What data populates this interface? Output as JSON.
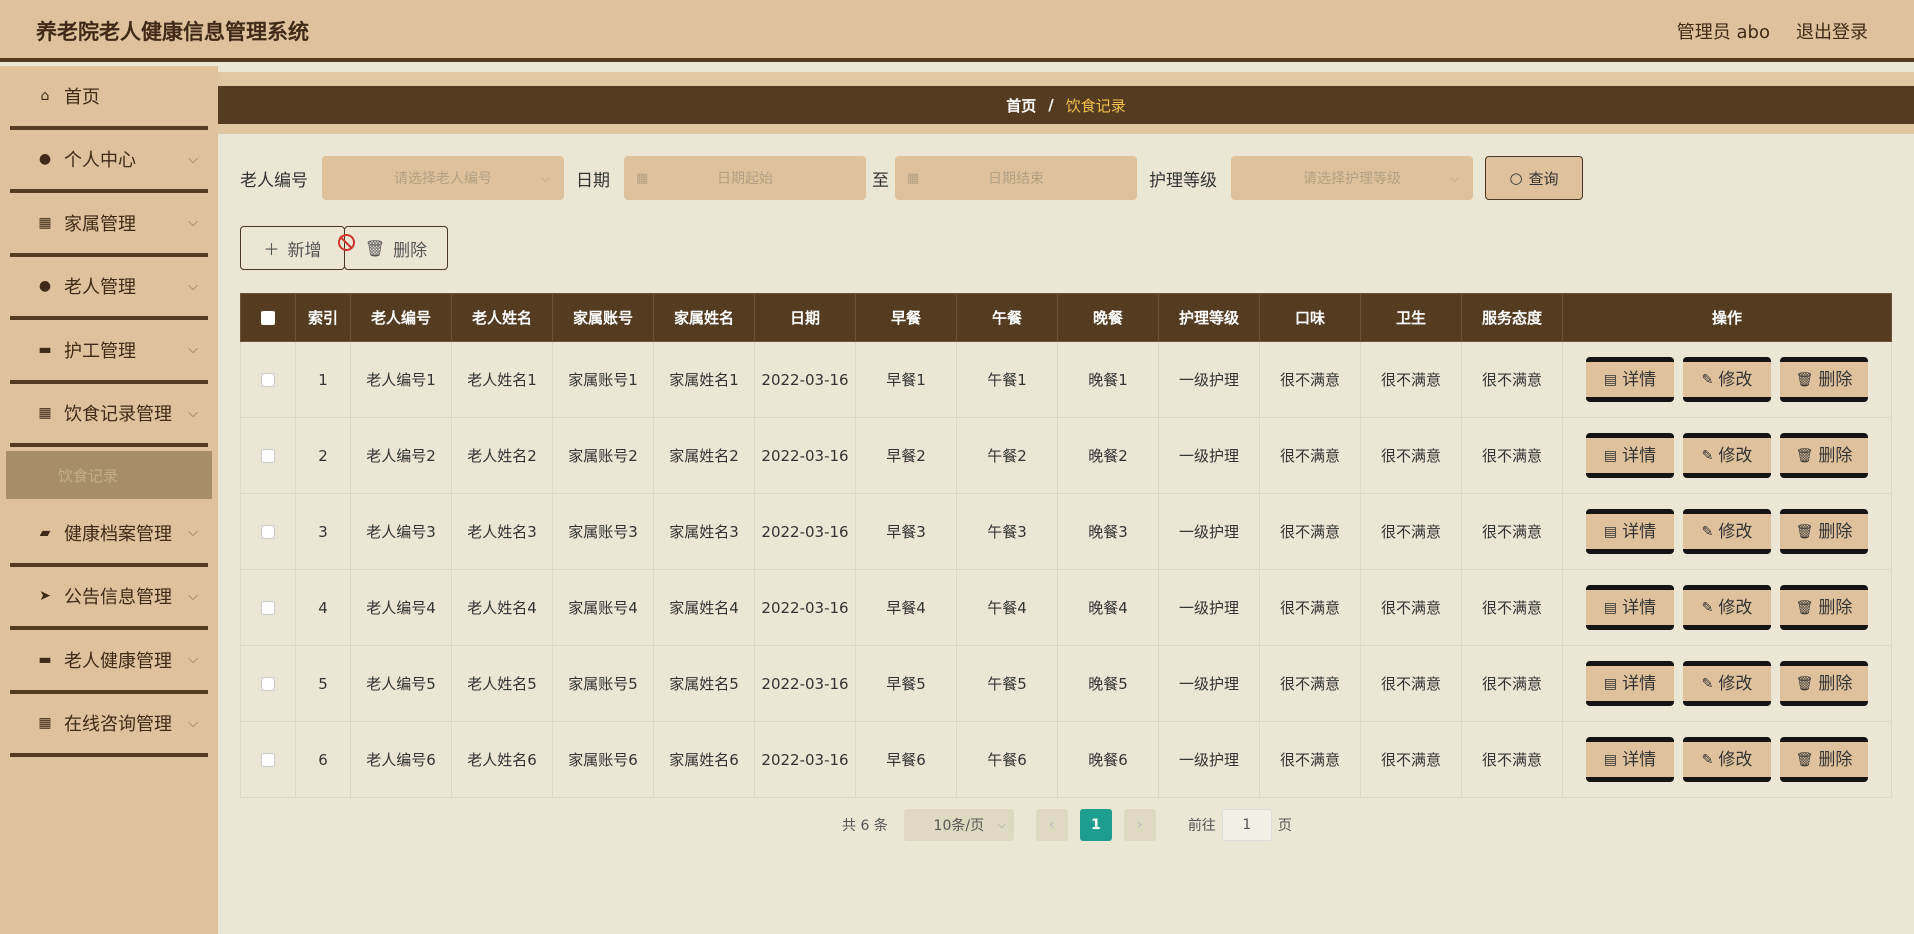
{
  "header": {
    "title": "养老院老人健康信息管理系统",
    "user": "管理员 abo",
    "logout": "退出登录"
  },
  "sidebar": {
    "items": [
      {
        "label": "首页",
        "icon": "home-icon",
        "glyph": "⌂",
        "has_children": false
      },
      {
        "label": "个人中心",
        "icon": "user-icon",
        "glyph": "●",
        "has_children": true
      },
      {
        "label": "家属管理",
        "icon": "grid-icon",
        "glyph": "▦",
        "has_children": true
      },
      {
        "label": "老人管理",
        "icon": "user-icon",
        "glyph": "●",
        "has_children": true
      },
      {
        "label": "护工管理",
        "icon": "message-icon",
        "glyph": "▬",
        "has_children": true
      },
      {
        "label": "饮食记录管理",
        "icon": "grid-icon",
        "glyph": "▦",
        "has_children": true
      },
      {
        "label": "健康档案管理",
        "icon": "folder-icon",
        "glyph": "▰",
        "has_children": true
      },
      {
        "label": "公告信息管理",
        "icon": "send-icon",
        "glyph": "➤",
        "has_children": true
      },
      {
        "label": "老人健康管理",
        "icon": "briefcase-icon",
        "glyph": "▬",
        "has_children": true
      },
      {
        "label": "在线咨询管理",
        "icon": "grid-icon",
        "glyph": "▦",
        "has_children": true
      }
    ],
    "sub_item": "饮食记录"
  },
  "breadcrumb": {
    "home": "首页",
    "sep": "/",
    "current": "饮食记录"
  },
  "search": {
    "elder_label": "老人编号",
    "elder_placeholder": "请选择老人编号",
    "date_label": "日期",
    "date_start_placeholder": "日期起始",
    "date_to": "至",
    "date_end_placeholder": "日期结束",
    "level_label": "护理等级",
    "level_placeholder": "请选择护理等级",
    "query": "查询"
  },
  "actions": {
    "add": "新增",
    "delete": "删除"
  },
  "table": {
    "columns": [
      "索引",
      "老人编号",
      "老人姓名",
      "家属账号",
      "家属姓名",
      "日期",
      "早餐",
      "午餐",
      "晚餐",
      "护理等级",
      "口味",
      "卫生",
      "服务态度",
      "操作"
    ],
    "rows": [
      [
        "1",
        "老人编号1",
        "老人姓名1",
        "家属账号1",
        "家属姓名1",
        "2022-03-16",
        "早餐1",
        "午餐1",
        "晚餐1",
        "一级护理",
        "很不满意",
        "很不满意",
        "很不满意"
      ],
      [
        "2",
        "老人编号2",
        "老人姓名2",
        "家属账号2",
        "家属姓名2",
        "2022-03-16",
        "早餐2",
        "午餐2",
        "晚餐2",
        "一级护理",
        "很不满意",
        "很不满意",
        "很不满意"
      ],
      [
        "3",
        "老人编号3",
        "老人姓名3",
        "家属账号3",
        "家属姓名3",
        "2022-03-16",
        "早餐3",
        "午餐3",
        "晚餐3",
        "一级护理",
        "很不满意",
        "很不满意",
        "很不满意"
      ],
      [
        "4",
        "老人编号4",
        "老人姓名4",
        "家属账号4",
        "家属姓名4",
        "2022-03-16",
        "早餐4",
        "午餐4",
        "晚餐4",
        "一级护理",
        "很不满意",
        "很不满意",
        "很不满意"
      ],
      [
        "5",
        "老人编号5",
        "老人姓名5",
        "家属账号5",
        "家属姓名5",
        "2022-03-16",
        "早餐5",
        "午餐5",
        "晚餐5",
        "一级护理",
        "很不满意",
        "很不满意",
        "很不满意"
      ],
      [
        "6",
        "老人编号6",
        "老人姓名6",
        "家属账号6",
        "家属姓名6",
        "2022-03-16",
        "早餐6",
        "午餐6",
        "晚餐6",
        "一级护理",
        "很不满意",
        "很不满意",
        "很不满意"
      ]
    ],
    "row_ops": {
      "detail": "详情",
      "edit": "修改",
      "delete": "删除"
    }
  },
  "pagination": {
    "total": "共 6 条",
    "page_size": "10条/页",
    "current_page": "1",
    "goto_label": "前往",
    "goto_value": "1",
    "page_suffix": "页"
  },
  "colors": {
    "header_bg": "#dfc29c",
    "dark_brown": "#553b20",
    "content_bg": "#ebe7d4",
    "active_page": "#1d9e8e",
    "breadcrumb_current": "#f2c24a"
  }
}
